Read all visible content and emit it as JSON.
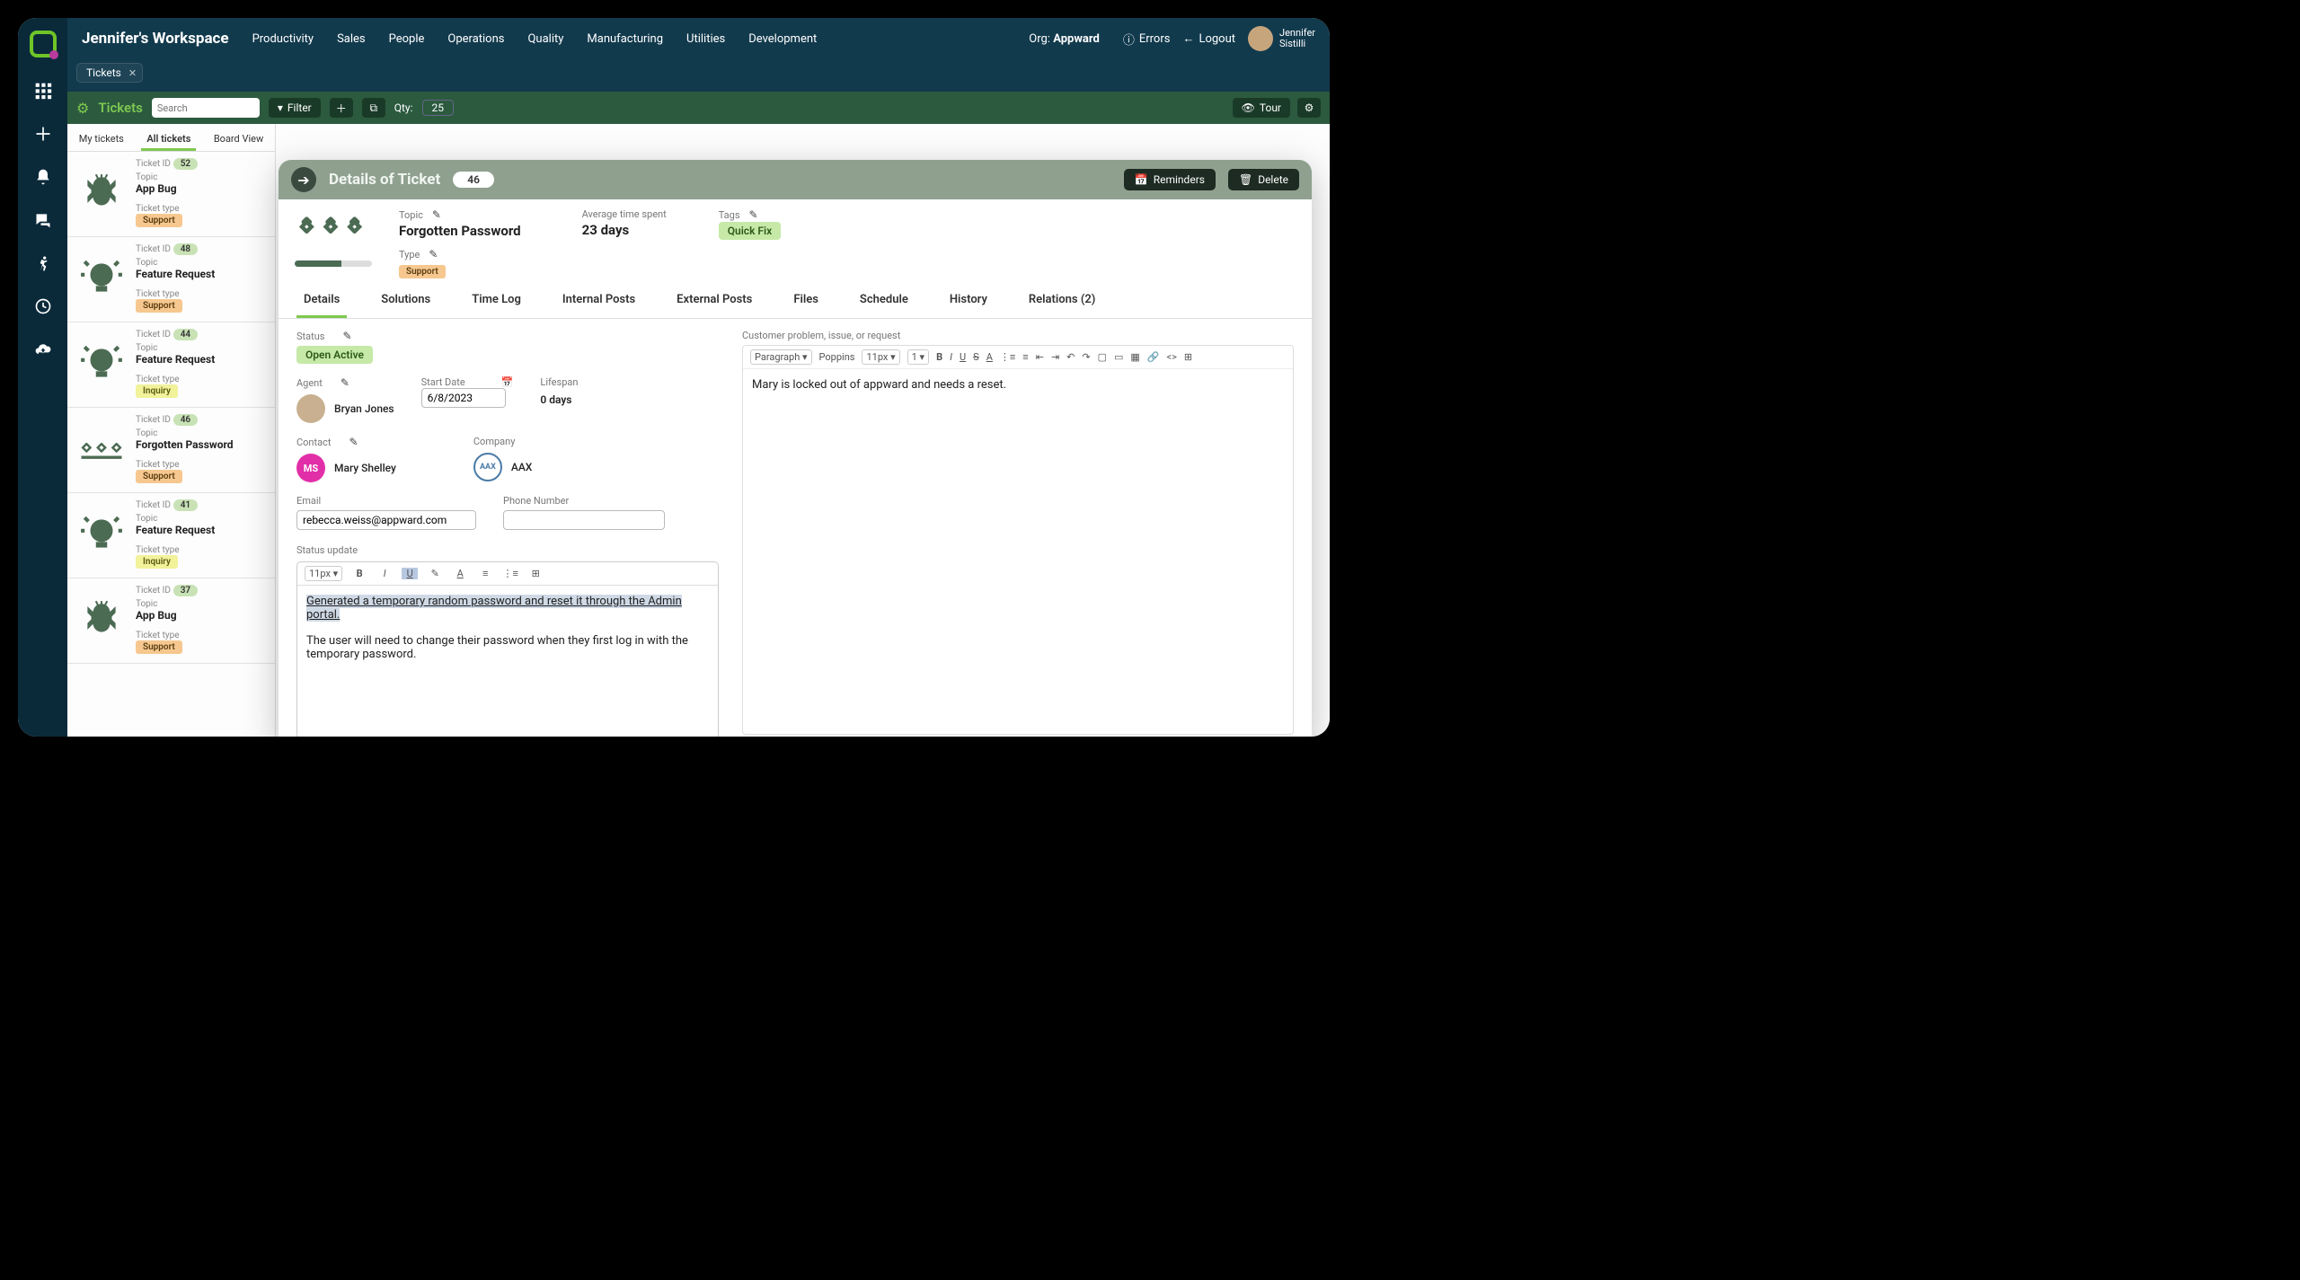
{
  "top": {
    "workspace": "Jennifer's Workspace",
    "nav": [
      "Productivity",
      "Sales",
      "People",
      "Operations",
      "Quality",
      "Manufacturing",
      "Utilities",
      "Development"
    ],
    "org_label": "Org:",
    "org_name": "Appward",
    "errors": "Errors",
    "logout": "Logout",
    "user_first": "Jennifer",
    "user_last": "Sistilli"
  },
  "tab": {
    "label": "Tickets"
  },
  "toolbar": {
    "title": "Tickets",
    "search_placeholder": "Search",
    "filter": "Filter",
    "qty_label": "Qty:",
    "qty": "25",
    "tour": "Tour"
  },
  "list_tabs": {
    "my": "My tickets",
    "all": "All tickets",
    "board": "Board View"
  },
  "labels": {
    "ticket_id": "Ticket ID",
    "topic": "Topic",
    "ticket_type": "Ticket type"
  },
  "tickets": [
    {
      "id": "52",
      "topic": "App Bug",
      "type": "Support",
      "type_class": "type-support",
      "icon": "bug"
    },
    {
      "id": "48",
      "topic": "Feature Request",
      "type": "Support",
      "type_class": "type-support",
      "icon": "idea"
    },
    {
      "id": "44",
      "topic": "Feature Request",
      "type": "Inquiry",
      "type_class": "type-inquiry",
      "icon": "idea"
    },
    {
      "id": "46",
      "topic": "Forgotten Password",
      "type": "Support",
      "type_class": "type-support",
      "icon": "pwd"
    },
    {
      "id": "41",
      "topic": "Feature Request",
      "type": "Inquiry",
      "type_class": "type-inquiry",
      "icon": "idea"
    },
    {
      "id": "37",
      "topic": "App Bug",
      "type": "Support",
      "type_class": "type-support",
      "icon": "bug"
    }
  ],
  "panel": {
    "title": "Details of Ticket",
    "id": "46",
    "reminders": "Reminders",
    "delete": "Delete",
    "topic_label": "Topic",
    "topic": "Forgotten Password",
    "type_label": "Type",
    "type": "Support",
    "avg_label": "Average time spent",
    "avg": "23 days",
    "tags_label": "Tags",
    "tag": "Quick Fix",
    "tabs": [
      "Details",
      "Solutions",
      "Time Log",
      "Internal Posts",
      "External Posts",
      "Files",
      "Schedule",
      "History",
      "Relations  (2)"
    ],
    "status_label": "Status",
    "status": "Open Active",
    "agent_label": "Agent",
    "agent": "Bryan Jones",
    "start_label": "Start Date",
    "start": "6/8/2023",
    "lifespan_label": "Lifespan",
    "lifespan": "0 days",
    "contact_label": "Contact",
    "contact": "Mary Shelley",
    "contact_initials": "MS",
    "company_label": "Company",
    "company": "AAX",
    "email_label": "Email",
    "email": "rebecca.weiss@appward.com",
    "phone_label": "Phone Number",
    "status_update_label": "Status update",
    "su_font": "11px",
    "su_line1": "Generated a temporary random password and reset it through the Admin portal.",
    "su_line2": "The user will need to change their password when they first log in with the temporary password.",
    "desc_label": "Customer problem, issue, or request",
    "desc_para": "Paragraph",
    "desc_font": "Poppins",
    "desc_size": "11px",
    "desc_lh": "1",
    "desc_text": "Mary is locked out of appward and needs a reset."
  }
}
